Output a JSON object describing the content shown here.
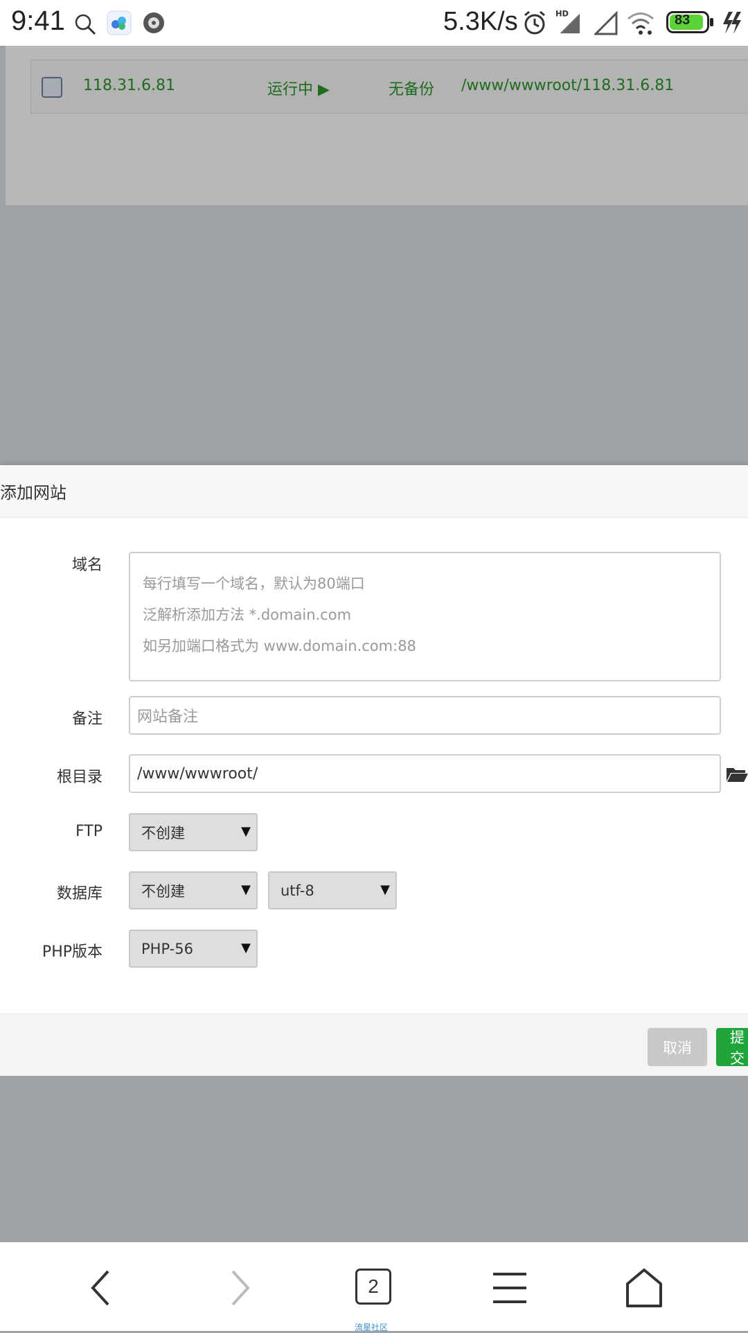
{
  "status_bar": {
    "time": "9:41",
    "net_speed": "5.3K/s",
    "battery": "83",
    "icons": [
      "search-icon",
      "app-cloud-icon",
      "app-tire-icon",
      "alarm-icon",
      "hd-signal-icon",
      "signal-icon",
      "wifi-icon",
      "battery-icon",
      "charging-icon"
    ]
  },
  "background_table": {
    "row": {
      "domain": "118.31.6.81",
      "status": "运行中 ▶",
      "backup": "无备份",
      "path": "/www/wwwroot/118.31.6.81"
    },
    "text_color": "#1e6b1e"
  },
  "modal": {
    "title": "添加网站",
    "fields": {
      "domain": {
        "label": "域名",
        "placeholder_lines": [
          "每行填写一个域名，默认为80端口",
          "泛解析添加方法 *.domain.com",
          "如另加端口格式为 www.domain.com:88"
        ]
      },
      "remark": {
        "label": "备注",
        "placeholder": "网站备注"
      },
      "root": {
        "label": "根目录",
        "value": "/www/wwwroot/"
      },
      "ftp": {
        "label": "FTP",
        "selected": "不创建"
      },
      "database": {
        "label": "数据库",
        "selected": "不创建",
        "charset_selected": "utf-8"
      },
      "php": {
        "label": "PHP版本",
        "selected": "PHP-56"
      }
    },
    "buttons": {
      "cancel": "取消",
      "submit": "提交"
    },
    "accent_color": "#20a53a"
  },
  "nav_bar": {
    "tab_count": "2",
    "watermark": "流星社区"
  }
}
